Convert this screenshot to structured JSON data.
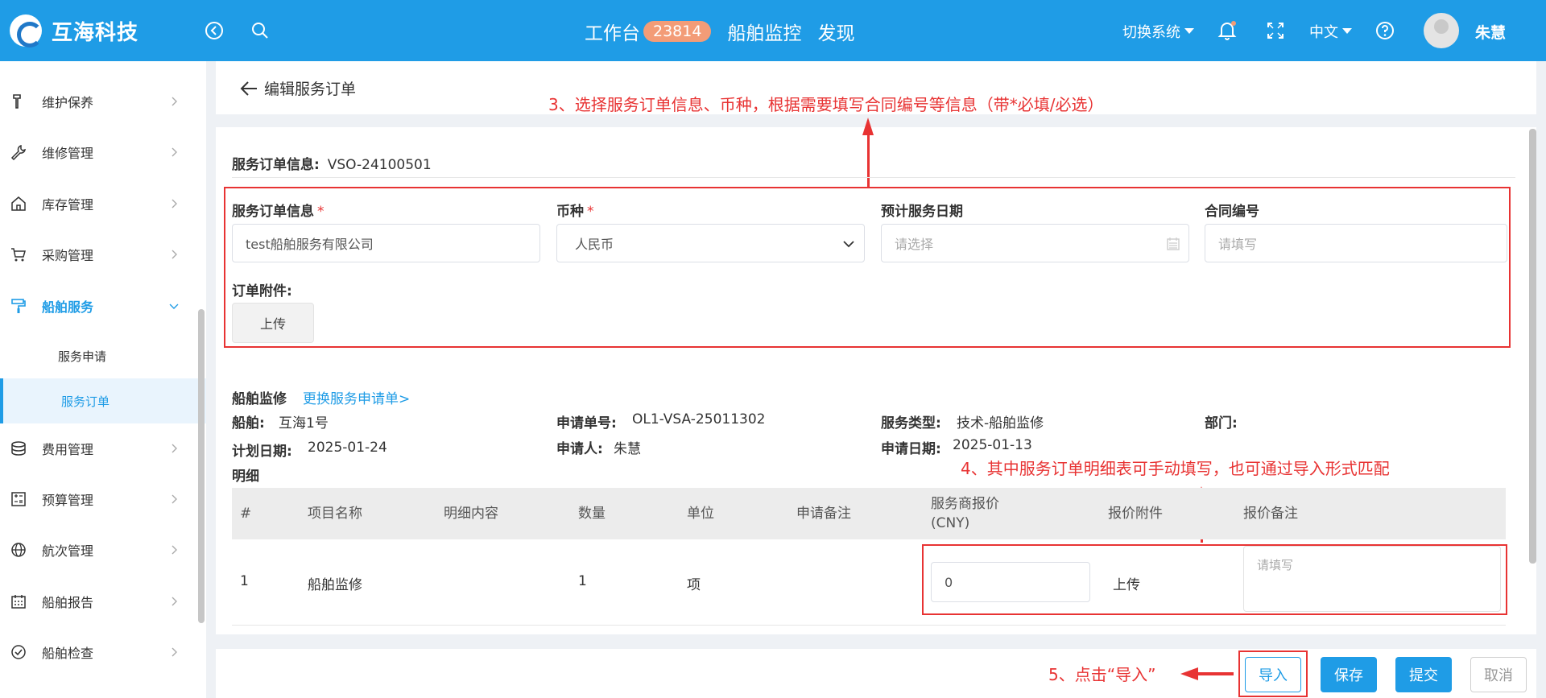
{
  "header": {
    "brand": "互海科技",
    "nav": {
      "workbench": "工作台",
      "workbench_badge": "23814",
      "ship_monitor": "船舶监控",
      "discover": "发现"
    },
    "switch_system": "切换系统",
    "language": "中文",
    "username": "朱慧"
  },
  "sidebar": {
    "items": [
      {
        "label": "维护保养",
        "icon": "wrench-icon"
      },
      {
        "label": "维修管理",
        "icon": "repair-icon"
      },
      {
        "label": "库存管理",
        "icon": "warehouse-icon"
      },
      {
        "label": "采购管理",
        "icon": "cart-icon"
      },
      {
        "label": "船舶服务",
        "icon": "roller-icon"
      },
      {
        "label": "费用管理",
        "icon": "coins-icon"
      },
      {
        "label": "预算管理",
        "icon": "calculator-icon"
      },
      {
        "label": "航次管理",
        "icon": "globe-icon"
      },
      {
        "label": "船舶报告",
        "icon": "calendar-icon"
      },
      {
        "label": "船舶检查",
        "icon": "check-circle-icon"
      }
    ],
    "sub_items": [
      {
        "label": "服务申请"
      },
      {
        "label": "服务订单"
      }
    ]
  },
  "page": {
    "title": "编辑服务订单",
    "order_info_label": "服务订单信息:",
    "order_info_value": "VSO-24100501"
  },
  "annotations": {
    "step3": "3、选择服务订单信息、币种，根据需要填写合同编号等信息（带*必填/必选）",
    "step4": "4、其中服务订单明细表可手动填写，也可通过导入形式匹配",
    "step5": "5、点击“导入”"
  },
  "form": {
    "order_info": {
      "label": "服务订单信息",
      "value": "test船舶服务有限公司"
    },
    "currency": {
      "label": "币种",
      "value": "人民币"
    },
    "service_date": {
      "label": "预计服务日期",
      "placeholder": "请选择"
    },
    "contract_no": {
      "label": "合同编号",
      "placeholder": "请填写"
    },
    "attachment_label": "订单附件:",
    "upload_label": "上传"
  },
  "request": {
    "category": "船舶监修",
    "change_link": "更换服务申请单>",
    "ship_label": "船舶:",
    "ship_value": "互海1号",
    "req_no_label": "申请单号:",
    "req_no_value": "OL1-VSA-25011302",
    "service_type_label": "服务类型:",
    "service_type_value": "技术-船舶监修",
    "dept_label": "部门:",
    "plan_date_label": "计划日期:",
    "plan_date_value": "2025-01-24",
    "applicant_label": "申请人:",
    "applicant_value": "朱慧",
    "apply_date_label": "申请日期:",
    "apply_date_value": "2025-01-13",
    "detail_label": "明细"
  },
  "table": {
    "headers": {
      "index": "#",
      "item_name": "项目名称",
      "content": "明细内容",
      "qty": "数量",
      "unit": "单位",
      "remark": "申请备注",
      "price_line1": "服务商报价",
      "price_line2": "(CNY)",
      "quote_attach": "报价附件",
      "quote_remark": "报价备注"
    },
    "rows": [
      {
        "index": "1",
        "item_name": "船舶监修",
        "qty": "1",
        "unit": "项",
        "price": "0",
        "upload": "上传",
        "remark_placeholder": "请填写"
      }
    ]
  },
  "footer": {
    "import": "导入",
    "save": "保存",
    "submit": "提交",
    "cancel": "取消"
  },
  "colors": {
    "primary": "#1f9ce6",
    "annotation": "#e83333",
    "badge": "#f39c77"
  }
}
